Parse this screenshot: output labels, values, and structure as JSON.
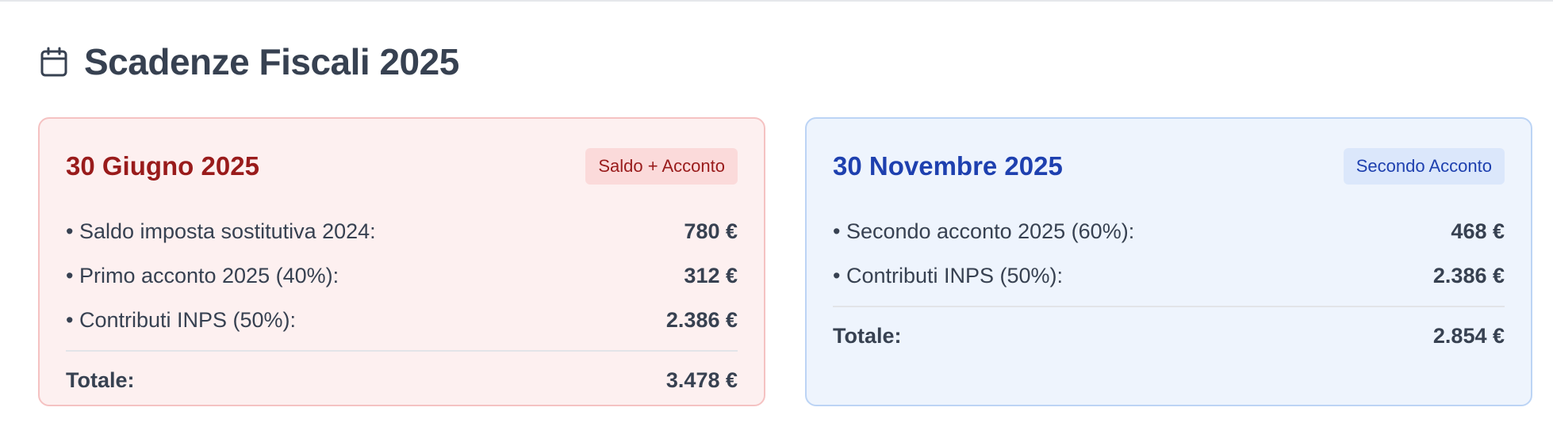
{
  "header": {
    "title": "Scadenze Fiscali 2025",
    "icon": "calendar-icon"
  },
  "cards": [
    {
      "title": "30 Giugno 2025",
      "badge": "Saldo + Acconto",
      "accent": "#991b1b",
      "items": [
        {
          "label": "• Saldo imposta sostitutiva 2024:",
          "amount": "780 €"
        },
        {
          "label": "• Primo acconto 2025 (40%):",
          "amount": "312 €"
        },
        {
          "label": "• Contributi INPS (50%):",
          "amount": "2.386 €"
        }
      ],
      "total_label": "Totale:",
      "total_amount": "3.478 €"
    },
    {
      "title": "30 Novembre 2025",
      "badge": "Secondo Acconto",
      "accent": "#1e40af",
      "items": [
        {
          "label": "• Secondo acconto 2025 (60%):",
          "amount": "468 €"
        },
        {
          "label": "• Contributi INPS (50%):",
          "amount": "2.386 €"
        }
      ],
      "total_label": "Totale:",
      "total_amount": "2.854 €"
    }
  ]
}
